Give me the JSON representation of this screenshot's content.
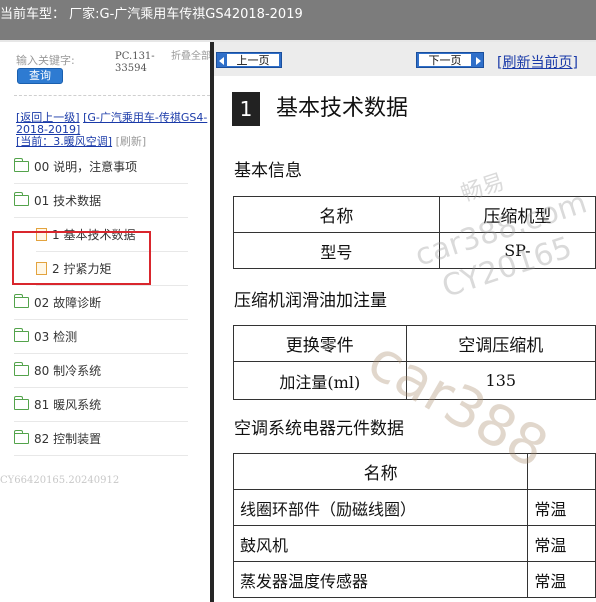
{
  "header": {
    "title": "当前车型： 厂家:G-广汽乘用车传祺GS42018-2019"
  },
  "sidebar": {
    "search_label": "输入关键字:",
    "search_button": "查询",
    "pc_code": "PC.131-33594",
    "fold_all": "折叠全部",
    "nav": {
      "back_link": "[返回上一级]",
      "model_link": "[G-广汽乘用车-传祺GS4-2018-2019]",
      "current_link": "[当前：3.暖风空调]",
      "refresh": "[刷新]"
    },
    "items": [
      {
        "label": "00 说明，注意事项"
      },
      {
        "label": "01 技术数据"
      },
      {
        "label": "1 基本技术数据"
      },
      {
        "label": "2 拧紧力矩"
      },
      {
        "label": "02 故障诊断"
      },
      {
        "label": "03 检测"
      },
      {
        "label": "80 制冷系统"
      },
      {
        "label": "81 暖风系统"
      },
      {
        "label": "82 控制装置"
      }
    ],
    "footer_code": "CY66420165.20240912"
  },
  "content": {
    "toolbar": {
      "prev_label": "上一页",
      "next_label": "下一页",
      "refresh_label": "[刷新当前页]"
    },
    "section_number": "1",
    "section_title": "基本技术数据",
    "basic_info": {
      "heading": "基本信息",
      "col1_header": "名称",
      "col2_header": "压缩机型",
      "row1_name": "型号",
      "row1_value": "SP-"
    },
    "oil": {
      "heading": "压缩机润滑油加注量",
      "col1_header": "更换零件",
      "col2_header": "空调压缩机",
      "row1_name": "加注量(ml)",
      "row1_value": "135"
    },
    "electrical": {
      "heading": "空调系统电器元件数据",
      "col1_header": "名称",
      "rows": [
        {
          "name": "线圈环部件（励磁线圈）",
          "value": "常温"
        },
        {
          "name": "鼓风机",
          "value": "常温"
        },
        {
          "name": "蒸发器温度传感器",
          "value": "常温"
        }
      ]
    },
    "watermark": {
      "brand_cn": "畅易",
      "site": "car388.com",
      "code": "CY20165",
      "big": "car388"
    }
  },
  "colors": {
    "topbar_bg": "#7c7c7c",
    "highlight_border": "#d9262d",
    "button_blue": "#2f6fc9",
    "link_blue": "#1a3aa8",
    "folder_green": "#53a34b",
    "doc_orange": "#e3a33e"
  }
}
